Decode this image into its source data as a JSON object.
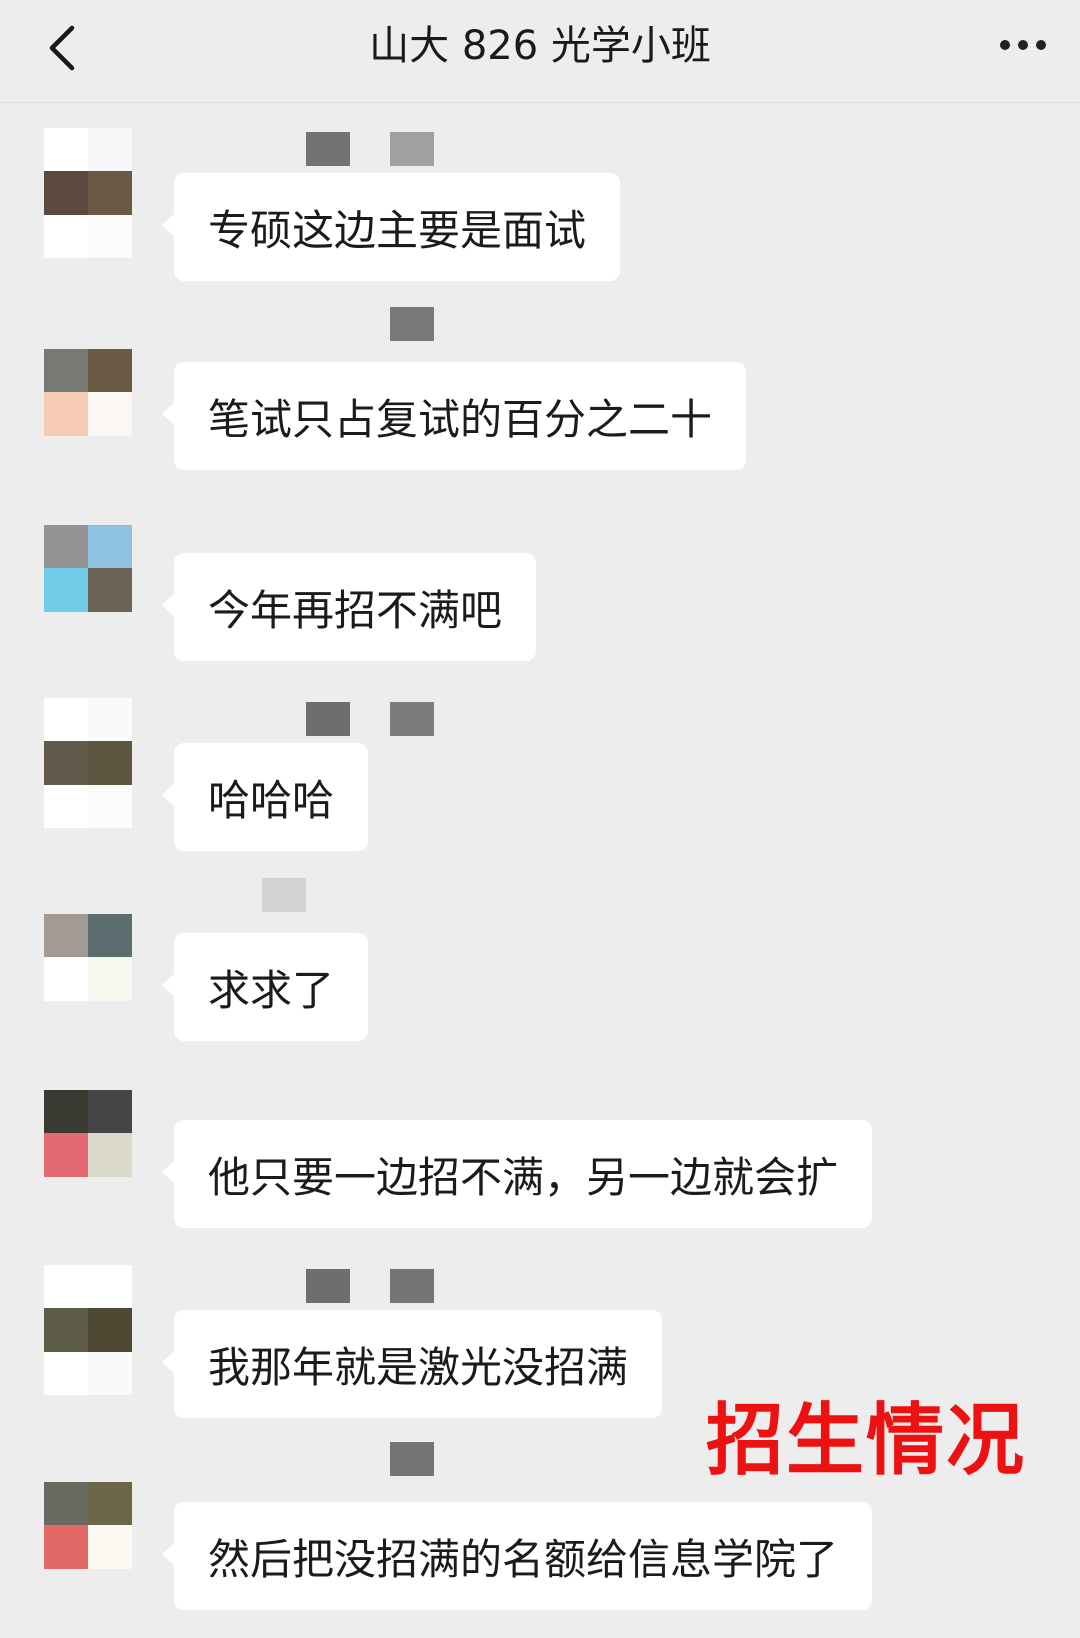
{
  "header": {
    "title": "山大 826 光学小班"
  },
  "messages": [
    {
      "text": "专硕这边主要是面试",
      "avatar": [
        [
          "#ffffff",
          "#f7f7f7"
        ],
        [
          "#5c4a40",
          "#6a5a44"
        ],
        [
          "#ffffff",
          "#fbfbfb"
        ]
      ],
      "sender": [
        "#727272",
        "#a0a0a0"
      ]
    },
    {
      "text": "笔试只占复试的百分之二十",
      "avatar": [
        [
          "#787874",
          "#6a5a44"
        ],
        [
          "#f6cdb4",
          "#fbf7f2"
        ],
        [
          "#ededed",
          "#ededed"
        ]
      ],
      "sender": [
        "#ededed",
        "#787878"
      ]
    },
    {
      "text": "今年再招不满吧",
      "avatar": [
        [
          "#939393",
          "#8ec2e0"
        ],
        [
          "#72cdea",
          "#6b6258"
        ],
        [
          "#ededed",
          "#ededed"
        ]
      ],
      "sender": []
    },
    {
      "text": "哈哈哈",
      "avatar": [
        [
          "#ffffff",
          "#fafafa"
        ],
        [
          "#635a4c",
          "#5e5640"
        ],
        [
          "#ffffff",
          "#fcfcfc"
        ]
      ],
      "sender": [
        "#6e6e6e",
        "#7c7c7c"
      ]
    },
    {
      "text": "求求了",
      "avatar": [
        [
          "#a39a94",
          "#5d6c6f"
        ],
        [
          "#ffffff",
          "#f4f8ee"
        ],
        [
          "#ededed",
          "#ededed"
        ]
      ],
      "sender": [
        "#d2d2d2"
      ]
    },
    {
      "text": "他只要一边招不满，另一边就会扩",
      "avatar": [
        [
          "#3a3a32",
          "#454545"
        ],
        [
          "#e36a72",
          "#dbd8cc"
        ],
        [
          "#ededed",
          "#ededed"
        ]
      ],
      "sender": []
    },
    {
      "text": "我那年就是激光没招满",
      "avatar": [
        [
          "#ffffff",
          "#ffffff"
        ],
        [
          "#5d5c46",
          "#4f4832"
        ],
        [
          "#ffffff",
          "#fafafa"
        ]
      ],
      "sender": [
        "#6e6e6e",
        "#757575"
      ]
    },
    {
      "text": "然后把没招满的名额给信息学院了",
      "avatar": [
        [
          "#6a6a62",
          "#6c6648"
        ],
        [
          "#e36868",
          "#fcf8f2"
        ],
        [
          "#ededed",
          "#ededed"
        ]
      ],
      "sender": [
        "#ededed",
        "#747474"
      ]
    }
  ],
  "overlay_caption": "招生情况"
}
